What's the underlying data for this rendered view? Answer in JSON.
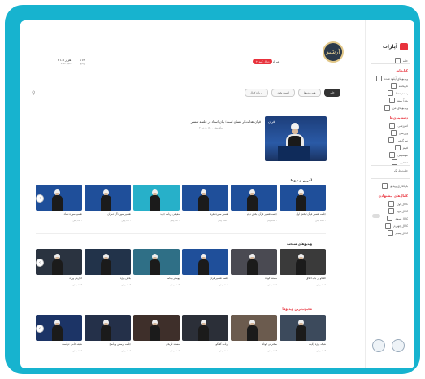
{
  "brand": {
    "name": "آپارات"
  },
  "sidebar": {
    "items_top": [
      "خانه",
      "ترندها",
      "دنبال‌شده‌ها",
      "مرور"
    ],
    "section1": {
      "title": "کتابخانه",
      "items": [
        "ویدیوهای آپلود شده",
        "تاریخچه",
        "پسندیده‌ها",
        "بعداً ببینم",
        "ویدیوهای من"
      ]
    },
    "section2": {
      "title": "دسته‌بندی‌ها",
      "items": [
        "آموزشی",
        "ورزشی",
        "سرگرمی",
        "فیلم",
        "موسیقی",
        "مذهبی"
      ]
    },
    "toggle_label": "حالت تاریک",
    "upload_label": "بارگذاری ویدیو",
    "section3": {
      "title": "کانال‌های پیشنهادی",
      "items": [
        "کانال اول",
        "کانال دوم",
        "کانال سوم",
        "کانال چهارم",
        "کانال پنجم"
      ]
    }
  },
  "channel": {
    "name": "مرکز آرشیو",
    "subscribe_label": "+ دنبال کنید",
    "avatar_text": "آرشیو",
    "stats": [
      {
        "value": "۲۱.۵ هزار",
        "label": "دنبال کننده"
      },
      {
        "value": "۱۱۳",
        "label": "ویدیو"
      }
    ]
  },
  "tabs": [
    "خانه",
    "همه ویدیوها",
    "لیست پخش",
    "درباره کانال"
  ],
  "featured": {
    "title": "قرآن هدایت‌گر انسان است؛ بیان استاد در جلسه تفسیر",
    "meta": "۳ ماه پیش · ۱۲۰ بازدید",
    "overlay": "قرآن"
  },
  "sections": [
    {
      "title": "آخرین ویدیوها",
      "red": false,
      "cards": [
        {
          "t": "جلسه تفسیر قرآن؛ بخش اول",
          "m": "۲ هفته پیش",
          "bg": "#1f4f9a"
        },
        {
          "t": "جلسه تفسیر قرآن؛ بخش دوم",
          "m": "۲ هفته پیش",
          "bg": "#1f4f9a"
        },
        {
          "t": "تفسیر سوره بقره",
          "m": "۳ هفته پیش",
          "bg": "#1f4f9a"
        },
        {
          "t": "معرفی برنامه جدید",
          "m": "۱ ماه پیش",
          "bg": "#27b0c9"
        },
        {
          "t": "تفسیر سوره آل عمران",
          "m": "۱ ماه پیش",
          "bg": "#1f4f9a"
        },
        {
          "t": "تفسیر سوره نساء",
          "m": "۱ ماه پیش",
          "bg": "#1f4f9a"
        }
      ]
    },
    {
      "title": "ویدیوهای منتخب",
      "red": false,
      "cards": [
        {
          "t": "گفتگو در باب اخلاق",
          "m": "۲ ماه پیش",
          "bg": "#3a3a3a"
        },
        {
          "t": "مستند کوتاه",
          "m": "۲ ماه پیش",
          "bg": "#4a4a52"
        },
        {
          "t": "جلسه تفسیر قرآن",
          "m": "۲ ماه پیش",
          "bg": "#1f4f9a"
        },
        {
          "t": "پوستر برنامه",
          "m": "۳ ماه پیش",
          "bg": "#2f6f86"
        },
        {
          "t": "بخش ویژه",
          "m": "۳ ماه پیش",
          "bg": "#22334a"
        },
        {
          "t": "گزارش ویژه",
          "m": "۳ ماه پیش",
          "bg": "#2a3340"
        }
      ]
    },
    {
      "title": "محبوب‌ترین ویدیوها",
      "red": true,
      "cards": [
        {
          "t": "شبکه ویژه ولایت",
          "m": "۴ ماه پیش",
          "bg": "#3c4a5c"
        },
        {
          "t": "سخنرانی کوتاه",
          "m": "۴ ماه پیش",
          "bg": "#6b5b4e"
        },
        {
          "t": "برنامه گفتگو",
          "m": "۴ ماه پیش",
          "bg": "#2b2f38"
        },
        {
          "t": "مستند تاریخی",
          "m": "۵ ماه پیش",
          "bg": "#3e2f2a"
        },
        {
          "t": "جلسه پرسش و پاسخ",
          "m": "۵ ماه پیش",
          "bg": "#243049"
        },
        {
          "t": "شیعه حامل عزاست",
          "m": "۵ ماه پیش",
          "bg": "#1c3466"
        }
      ]
    }
  ]
}
